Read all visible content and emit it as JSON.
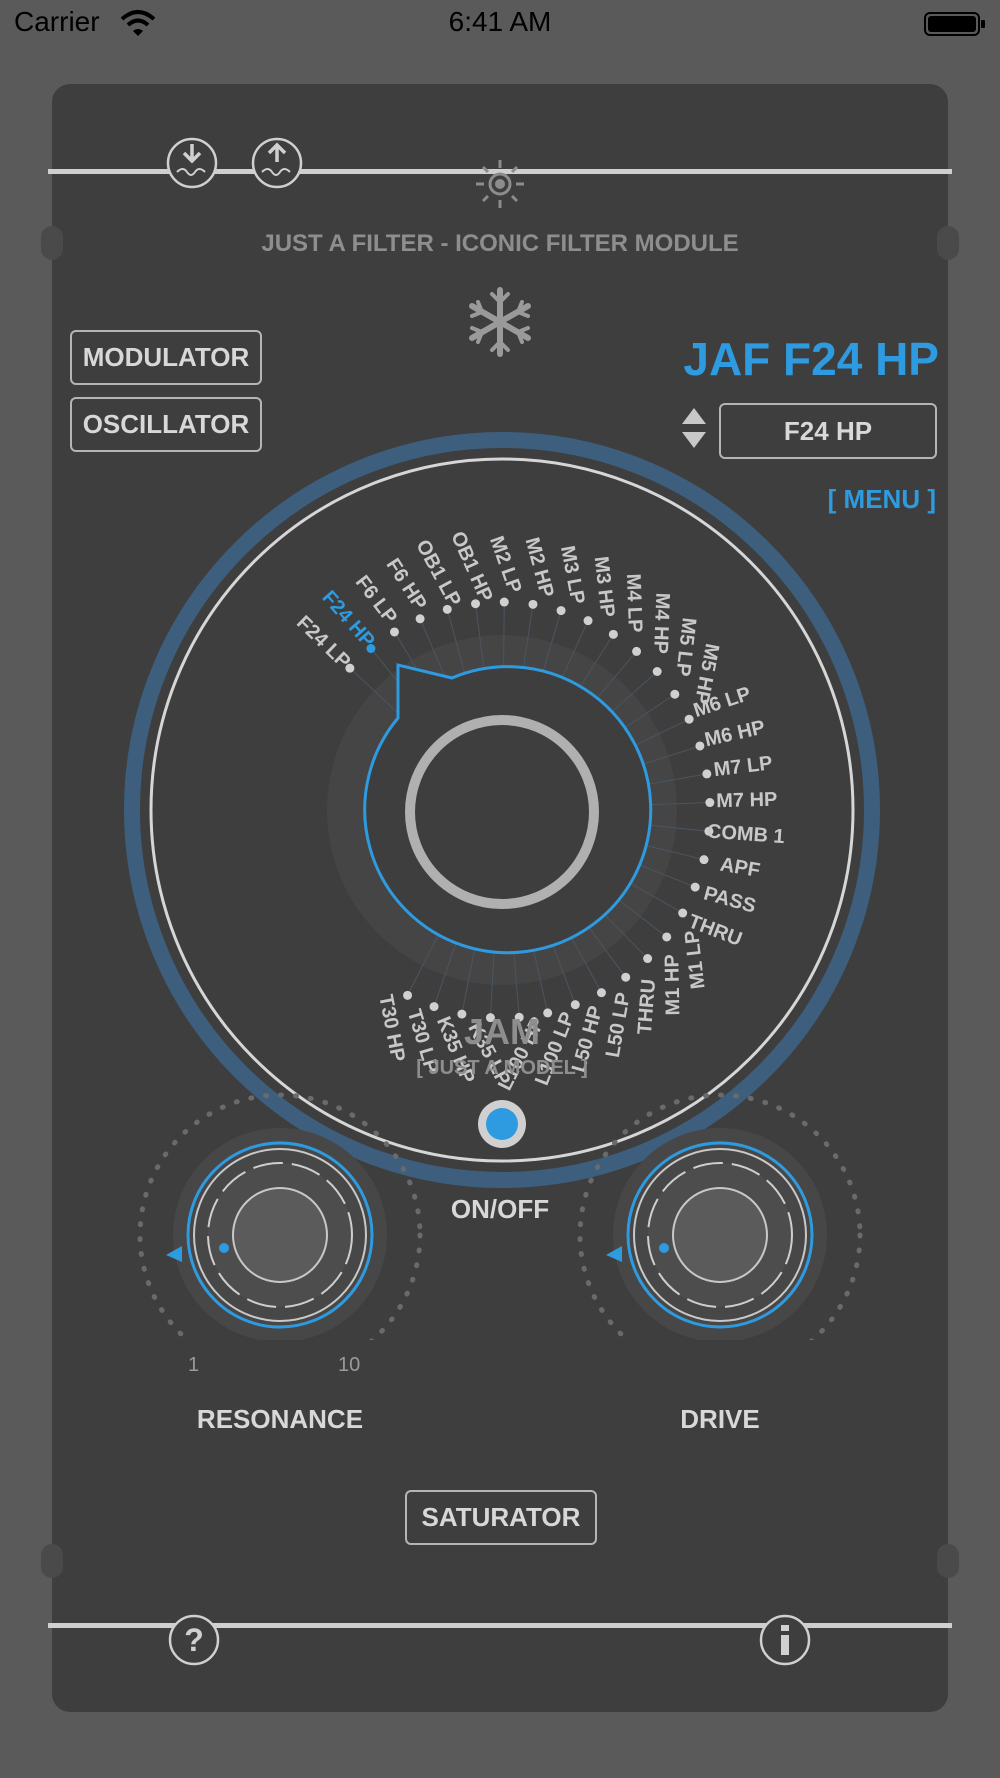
{
  "status_bar": {
    "carrier": "Carrier",
    "time": "6:41 AM"
  },
  "header": {
    "title": "JUST A FILTER - ICONIC FILTER MODULE"
  },
  "buttons": {
    "modulator": "MODULATOR",
    "oscillator": "OSCILLATOR",
    "saturator": "SATURATOR"
  },
  "preset": {
    "name": "JAF F24 HP",
    "selected": "F24 HP",
    "menu": "[ MENU ]"
  },
  "filter_dial": {
    "types": [
      "F24 LP",
      "F24 HP",
      "F6 LP",
      "F6 HP",
      "OB1 LP",
      "OB1 HP",
      "M2 LP",
      "M2 HP",
      "M3 LP",
      "M3 HP",
      "M4 LP",
      "M4 HP",
      "M5 LP",
      "M5 HP",
      "M6 LP",
      "M6 HP",
      "M7 LP",
      "M7 HP",
      "COMB 1",
      "APF",
      "PASS",
      "THRU",
      "M1 LP",
      "M1 HP",
      "THRU",
      "L50 LP",
      "L50 HP",
      "L100 LP",
      "L100 HP",
      "K35 LP",
      "K35 HP",
      "T30 LP",
      "T30 HP"
    ],
    "selected": "F24 HP",
    "model_title": "JAM",
    "model_subtitle": "[ JUST A MODEL ]"
  },
  "power": {
    "label": "ON/OFF"
  },
  "knobs": {
    "resonance": {
      "label": "RESONANCE",
      "min_label": "1",
      "max_label": "10",
      "value_fraction": 0
    },
    "drive": {
      "label": "DRIVE",
      "value_fraction": 0
    }
  },
  "colors": {
    "accent": "#2e9be0",
    "panel": "#3e3e3e",
    "background": "#5a5a5a",
    "text": "#d8d8d8"
  },
  "icons": [
    "download-midi-icon",
    "upload-midi-icon",
    "sun-icon",
    "snowflake-icon",
    "arrow-updown-icon",
    "help-icon",
    "info-icon",
    "wifi-icon",
    "battery-icon"
  ]
}
